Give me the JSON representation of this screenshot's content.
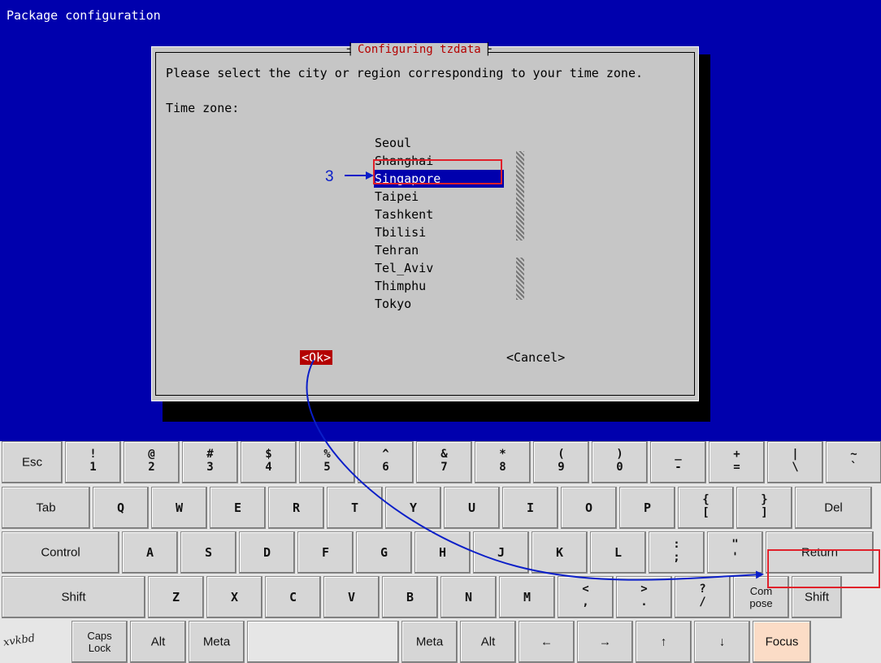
{
  "terminal": {
    "title": "Package configuration"
  },
  "dialog": {
    "title": "Configuring tzdata",
    "prompt": "Please select the city or region corresponding to your time zone.",
    "field_label": "Time zone:",
    "zones": [
      "Seoul",
      "Shanghai",
      "Singapore",
      "Taipei",
      "Tashkent",
      "Tbilisi",
      "Tehran",
      "Tel_Aviv",
      "Thimphu",
      "Tokyo"
    ],
    "selected_zone": "Singapore",
    "ok_label": "<Ok>",
    "cancel_label": "<Cancel>"
  },
  "keyboard": {
    "brand": "xvkbd",
    "row1": [
      {
        "l": "Esc"
      },
      {
        "t": "!",
        "b": "1"
      },
      {
        "t": "@",
        "b": "2"
      },
      {
        "t": "#",
        "b": "3"
      },
      {
        "t": "$",
        "b": "4"
      },
      {
        "t": "%",
        "b": "5"
      },
      {
        "t": "^",
        "b": "6"
      },
      {
        "t": "&",
        "b": "7"
      },
      {
        "t": "*",
        "b": "8"
      },
      {
        "t": "(",
        "b": "9"
      },
      {
        "t": ")",
        "b": "0"
      },
      {
        "t": "_",
        "b": "-"
      },
      {
        "t": "+",
        "b": "="
      },
      {
        "t": "|",
        "b": "\\"
      },
      {
        "t": "~",
        "b": "`"
      }
    ],
    "row2": [
      "Tab",
      "Q",
      "W",
      "E",
      "R",
      "T",
      "Y",
      "U",
      "I",
      "O",
      "P",
      {
        "t": "{",
        "b": "["
      },
      {
        "t": "}",
        "b": "]"
      },
      "Del"
    ],
    "row3": [
      "Control",
      "A",
      "S",
      "D",
      "F",
      "G",
      "H",
      "J",
      "K",
      "L",
      {
        "t": ":",
        "b": ";"
      },
      {
        "t": "\"",
        "b": "'"
      },
      "Return"
    ],
    "row4": [
      "Shift",
      "Z",
      "X",
      "C",
      "V",
      "B",
      "N",
      "M",
      {
        "t": "<",
        "b": ","
      },
      {
        "t": ">",
        "b": "."
      },
      {
        "t": "?",
        "b": "/"
      },
      "Com pose",
      "Shift"
    ],
    "row5": [
      "Caps Lock",
      "Alt",
      "Meta",
      "",
      "Meta",
      "Alt",
      "←",
      "→",
      "↑",
      "↓",
      "Focus"
    ]
  },
  "annotations": {
    "step_number": "3",
    "arrow_color": "#0a1ec8",
    "highlight_color": "#e0202a"
  }
}
